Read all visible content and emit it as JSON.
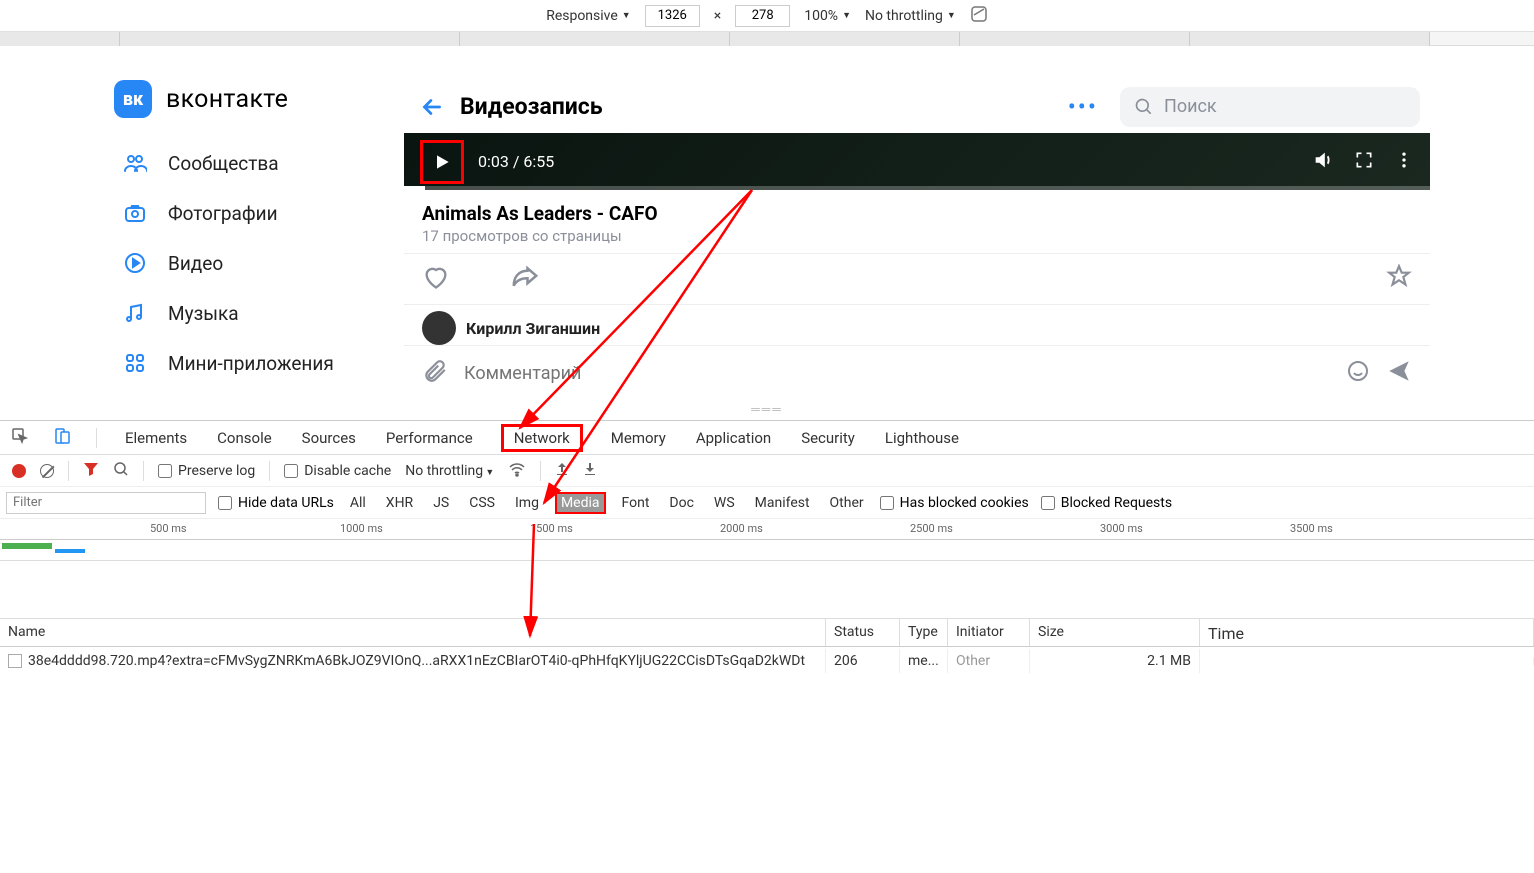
{
  "device_toolbar": {
    "mode": "Responsive",
    "width": "1326",
    "height": "278",
    "zoom": "100%",
    "throttling": "No throttling"
  },
  "vk": {
    "logo_text": "вконтакте",
    "logo_abbr": "вк",
    "nav": [
      {
        "label": "Сообщества"
      },
      {
        "label": "Фотографии"
      },
      {
        "label": "Видео"
      },
      {
        "label": "Музыка"
      },
      {
        "label": "Мини-приложения"
      }
    ],
    "page_title": "Видеозапись",
    "search_placeholder": "Поиск",
    "video": {
      "current_time": "0:03",
      "duration": "6:55",
      "title": "Animals As Leaders - CAFO",
      "views": "17 просмотров со страницы",
      "user_name": "Кирилл Зиганшин"
    },
    "comment_placeholder": "Комментарий"
  },
  "devtools": {
    "tabs": [
      "Elements",
      "Console",
      "Sources",
      "Performance",
      "Network",
      "Memory",
      "Application",
      "Security",
      "Lighthouse"
    ],
    "toolbar": {
      "preserve_log": "Preserve log",
      "disable_cache": "Disable cache",
      "throttling": "No throttling"
    },
    "filter": {
      "placeholder": "Filter",
      "hide_urls": "Hide data URLs",
      "types": [
        "All",
        "XHR",
        "JS",
        "CSS",
        "Img",
        "Media",
        "Font",
        "Doc",
        "WS",
        "Manifest",
        "Other"
      ],
      "blocked_cookies": "Has blocked cookies",
      "blocked_requests": "Blocked Requests"
    },
    "timeline_labels": [
      "500 ms",
      "1000 ms",
      "1500 ms",
      "2000 ms",
      "2500 ms",
      "3000 ms",
      "3500 ms"
    ],
    "columns": {
      "name": "Name",
      "status": "Status",
      "type": "Type",
      "initiator": "Initiator",
      "size": "Size",
      "time": "Time"
    },
    "row": {
      "name": "38e4dddd98.720.mp4?extra=cFMvSygZNRKmA6BkJOZ9VIOnQ...aRXX1nEzCBIarOT4i0-qPhHfqKYljUG22CCisDTsGqaD2kWDt",
      "status": "206",
      "type": "me...",
      "initiator": "Other",
      "size": "2.1 MB"
    }
  }
}
